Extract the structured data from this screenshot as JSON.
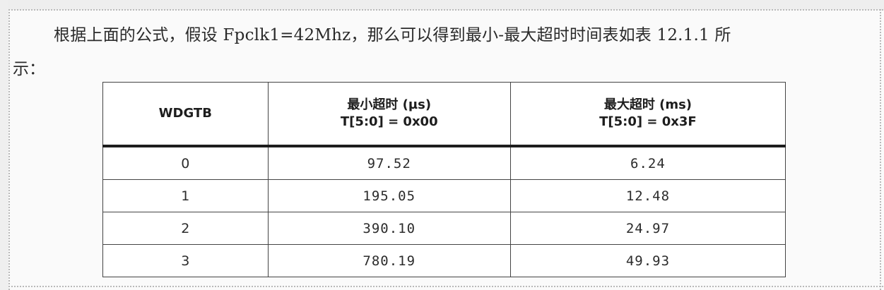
{
  "paragraph": {
    "line1": "根据上面的公式，假设 Fpclk1=42Mhz，那么可以得到最小-最大超时时间表如表 12.1.1 所",
    "line2": "示："
  },
  "table": {
    "headers": {
      "wdgtb": "WDGTB",
      "min_line1": "最小超时 (µs)",
      "min_line2": "T[5:0] = 0x00",
      "max_line1": "最大超时 (ms)",
      "max_line2": "T[5:0] = 0x3F"
    },
    "rows": [
      {
        "wdgtb": "0",
        "min": "97.52",
        "max": "6.24"
      },
      {
        "wdgtb": "1",
        "min": "195.05",
        "max": "12.48"
      },
      {
        "wdgtb": "2",
        "min": "390.10",
        "max": "24.97"
      },
      {
        "wdgtb": "3",
        "min": "780.19",
        "max": "49.93"
      }
    ]
  }
}
